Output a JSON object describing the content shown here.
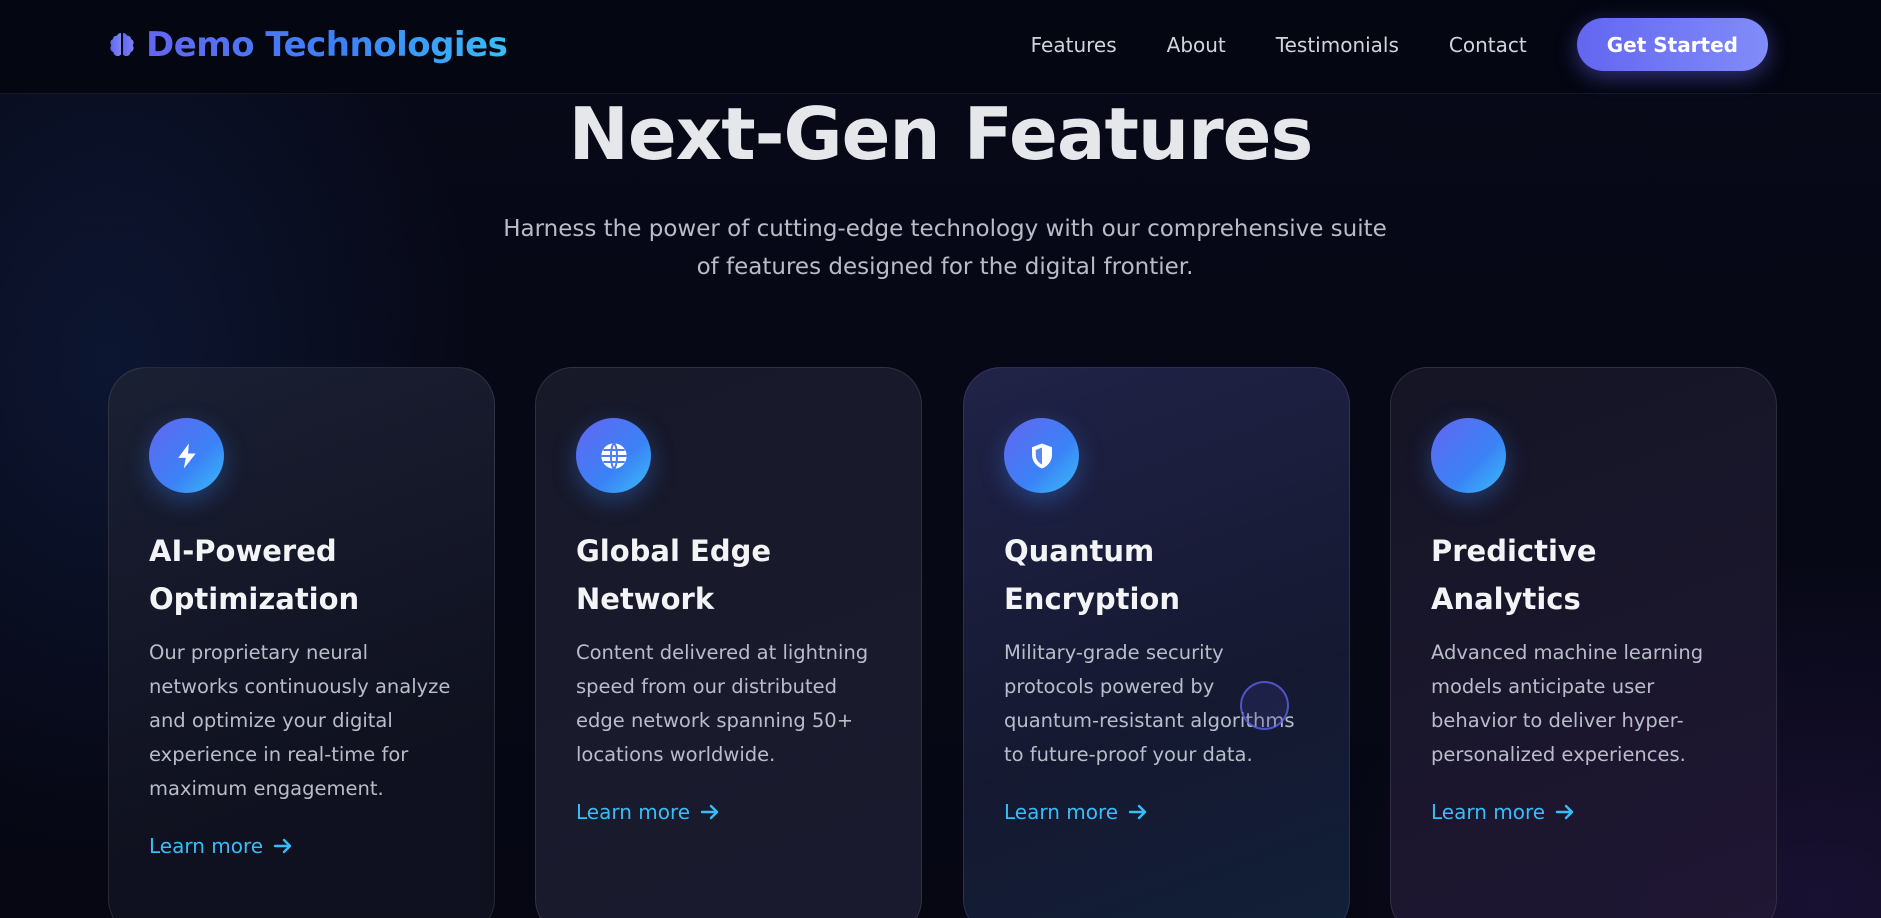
{
  "nav": {
    "brand": "Demo Technologies",
    "brand_icon": "brain-icon",
    "links": [
      "Features",
      "About",
      "Testimonials",
      "Contact"
    ],
    "cta": "Get Started"
  },
  "hero": {
    "title": "Next-Gen Features",
    "subtitle_line1": "Harness the power of cutting-edge technology with our comprehensive suite",
    "subtitle_line2": "of features designed for the digital frontier."
  },
  "cards": [
    {
      "icon": "lightning-bolt-icon",
      "title": "AI-Powered Optimization",
      "description": "Our proprietary neural networks continuously analyze and optimize your digital experience in real-time for maximum engagement.",
      "link": "Learn more"
    },
    {
      "icon": "globe-icon",
      "title": "Global Edge Network",
      "description": "Content delivered at lightning speed from our distributed edge network spanning 50+ locations worldwide.",
      "link": "Learn more"
    },
    {
      "icon": "shield-icon",
      "title": "Quantum Encryption",
      "description": "Military-grade security protocols powered by quantum-resistant algorithms to future-proof your data.",
      "link": "Learn more"
    },
    {
      "icon": "analytics-icon",
      "title": "Predictive Analytics",
      "description": "Advanced machine learning models anticipate user behavior to deliver hyper-personalized experiences.",
      "link": "Learn more"
    }
  ],
  "colors": {
    "accent_indigo": "#6366f1",
    "accent_blue": "#3b82f6",
    "accent_cyan": "#38bdf8",
    "background": "#05060f"
  }
}
